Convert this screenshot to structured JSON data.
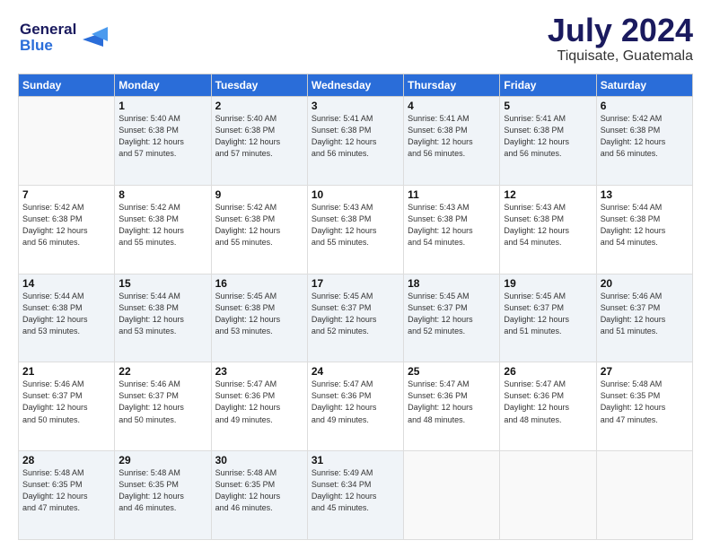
{
  "header": {
    "logo_line1": "General",
    "logo_line2": "Blue",
    "month": "July 2024",
    "location": "Tiquisate, Guatemala"
  },
  "days_of_week": [
    "Sunday",
    "Monday",
    "Tuesday",
    "Wednesday",
    "Thursday",
    "Friday",
    "Saturday"
  ],
  "weeks": [
    [
      {
        "day": "",
        "info": ""
      },
      {
        "day": "1",
        "info": "Sunrise: 5:40 AM\nSunset: 6:38 PM\nDaylight: 12 hours\nand 57 minutes."
      },
      {
        "day": "2",
        "info": "Sunrise: 5:40 AM\nSunset: 6:38 PM\nDaylight: 12 hours\nand 57 minutes."
      },
      {
        "day": "3",
        "info": "Sunrise: 5:41 AM\nSunset: 6:38 PM\nDaylight: 12 hours\nand 56 minutes."
      },
      {
        "day": "4",
        "info": "Sunrise: 5:41 AM\nSunset: 6:38 PM\nDaylight: 12 hours\nand 56 minutes."
      },
      {
        "day": "5",
        "info": "Sunrise: 5:41 AM\nSunset: 6:38 PM\nDaylight: 12 hours\nand 56 minutes."
      },
      {
        "day": "6",
        "info": "Sunrise: 5:42 AM\nSunset: 6:38 PM\nDaylight: 12 hours\nand 56 minutes."
      }
    ],
    [
      {
        "day": "7",
        "info": "Sunrise: 5:42 AM\nSunset: 6:38 PM\nDaylight: 12 hours\nand 56 minutes."
      },
      {
        "day": "8",
        "info": "Sunrise: 5:42 AM\nSunset: 6:38 PM\nDaylight: 12 hours\nand 55 minutes."
      },
      {
        "day": "9",
        "info": "Sunrise: 5:42 AM\nSunset: 6:38 PM\nDaylight: 12 hours\nand 55 minutes."
      },
      {
        "day": "10",
        "info": "Sunrise: 5:43 AM\nSunset: 6:38 PM\nDaylight: 12 hours\nand 55 minutes."
      },
      {
        "day": "11",
        "info": "Sunrise: 5:43 AM\nSunset: 6:38 PM\nDaylight: 12 hours\nand 54 minutes."
      },
      {
        "day": "12",
        "info": "Sunrise: 5:43 AM\nSunset: 6:38 PM\nDaylight: 12 hours\nand 54 minutes."
      },
      {
        "day": "13",
        "info": "Sunrise: 5:44 AM\nSunset: 6:38 PM\nDaylight: 12 hours\nand 54 minutes."
      }
    ],
    [
      {
        "day": "14",
        "info": "Sunrise: 5:44 AM\nSunset: 6:38 PM\nDaylight: 12 hours\nand 53 minutes."
      },
      {
        "day": "15",
        "info": "Sunrise: 5:44 AM\nSunset: 6:38 PM\nDaylight: 12 hours\nand 53 minutes."
      },
      {
        "day": "16",
        "info": "Sunrise: 5:45 AM\nSunset: 6:38 PM\nDaylight: 12 hours\nand 53 minutes."
      },
      {
        "day": "17",
        "info": "Sunrise: 5:45 AM\nSunset: 6:37 PM\nDaylight: 12 hours\nand 52 minutes."
      },
      {
        "day": "18",
        "info": "Sunrise: 5:45 AM\nSunset: 6:37 PM\nDaylight: 12 hours\nand 52 minutes."
      },
      {
        "day": "19",
        "info": "Sunrise: 5:45 AM\nSunset: 6:37 PM\nDaylight: 12 hours\nand 51 minutes."
      },
      {
        "day": "20",
        "info": "Sunrise: 5:46 AM\nSunset: 6:37 PM\nDaylight: 12 hours\nand 51 minutes."
      }
    ],
    [
      {
        "day": "21",
        "info": "Sunrise: 5:46 AM\nSunset: 6:37 PM\nDaylight: 12 hours\nand 50 minutes."
      },
      {
        "day": "22",
        "info": "Sunrise: 5:46 AM\nSunset: 6:37 PM\nDaylight: 12 hours\nand 50 minutes."
      },
      {
        "day": "23",
        "info": "Sunrise: 5:47 AM\nSunset: 6:36 PM\nDaylight: 12 hours\nand 49 minutes."
      },
      {
        "day": "24",
        "info": "Sunrise: 5:47 AM\nSunset: 6:36 PM\nDaylight: 12 hours\nand 49 minutes."
      },
      {
        "day": "25",
        "info": "Sunrise: 5:47 AM\nSunset: 6:36 PM\nDaylight: 12 hours\nand 48 minutes."
      },
      {
        "day": "26",
        "info": "Sunrise: 5:47 AM\nSunset: 6:36 PM\nDaylight: 12 hours\nand 48 minutes."
      },
      {
        "day": "27",
        "info": "Sunrise: 5:48 AM\nSunset: 6:35 PM\nDaylight: 12 hours\nand 47 minutes."
      }
    ],
    [
      {
        "day": "28",
        "info": "Sunrise: 5:48 AM\nSunset: 6:35 PM\nDaylight: 12 hours\nand 47 minutes."
      },
      {
        "day": "29",
        "info": "Sunrise: 5:48 AM\nSunset: 6:35 PM\nDaylight: 12 hours\nand 46 minutes."
      },
      {
        "day": "30",
        "info": "Sunrise: 5:48 AM\nSunset: 6:35 PM\nDaylight: 12 hours\nand 46 minutes."
      },
      {
        "day": "31",
        "info": "Sunrise: 5:49 AM\nSunset: 6:34 PM\nDaylight: 12 hours\nand 45 minutes."
      },
      {
        "day": "",
        "info": ""
      },
      {
        "day": "",
        "info": ""
      },
      {
        "day": "",
        "info": ""
      }
    ]
  ]
}
